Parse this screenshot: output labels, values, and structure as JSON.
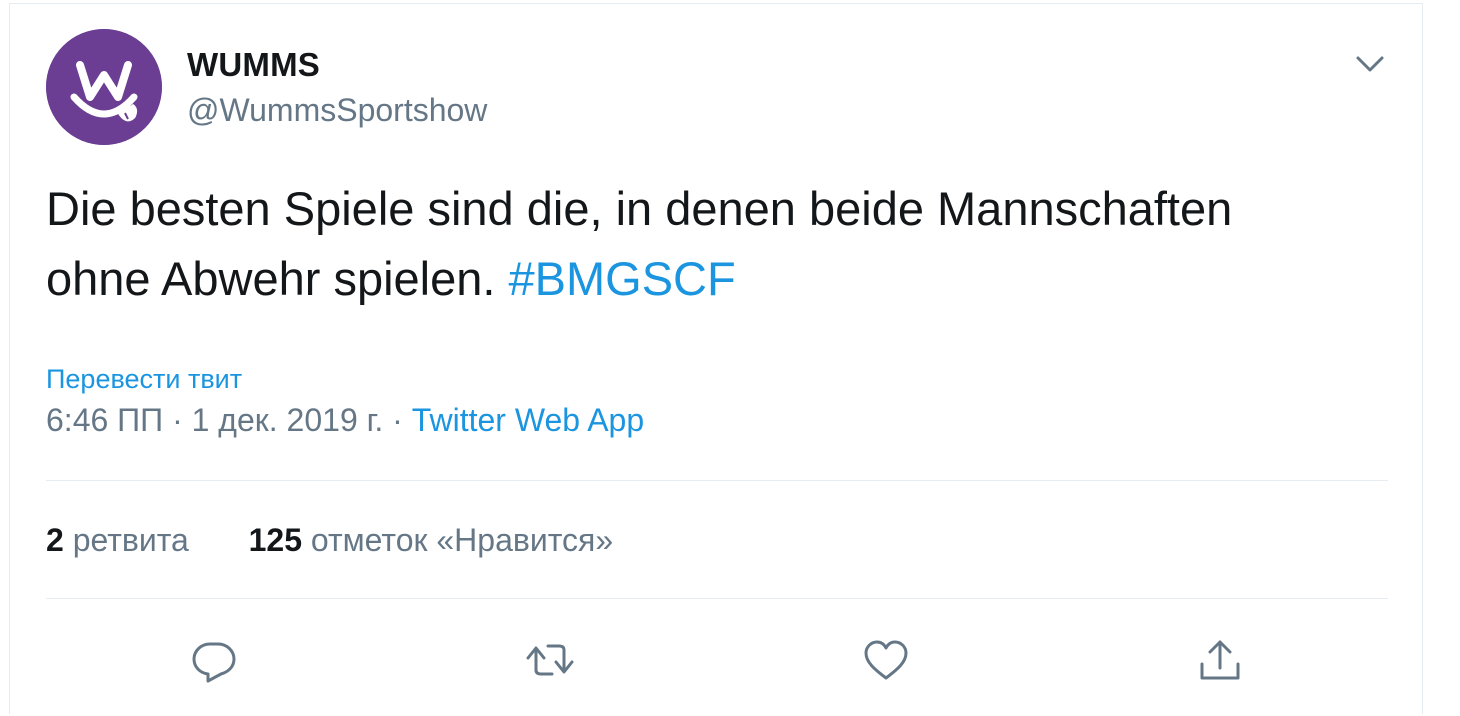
{
  "tweet": {
    "author_name": "WUMMS",
    "author_handle": "@WummsSportshow",
    "text_line1": "Die besten Spiele sind die, in denen beide Mannschaften",
    "text_line2": "ohne Abwehr spielen.",
    "hashtag": "#BMGSCF",
    "translate_label": "Перевести твит",
    "time": "6:46 ПП",
    "date": "1 дек. 2019 г.",
    "separator": "·",
    "source": "Twitter Web App"
  },
  "stats": {
    "retweets_count": "2",
    "retweets_label": "ретвита",
    "likes_count": "125",
    "likes_label": "отметок «Нравится»"
  },
  "icons": {
    "avatar": "wumms-logo",
    "menu": "chevron-down-icon",
    "reply": "reply-icon",
    "retweet": "retweet-icon",
    "like": "heart-icon",
    "share": "share-icon"
  },
  "colors": {
    "link": "#1b95e0",
    "secondary_text": "#657786",
    "primary_text": "#14171a",
    "avatar_bg": "#6b3e94",
    "divider": "#e6ecf0"
  }
}
